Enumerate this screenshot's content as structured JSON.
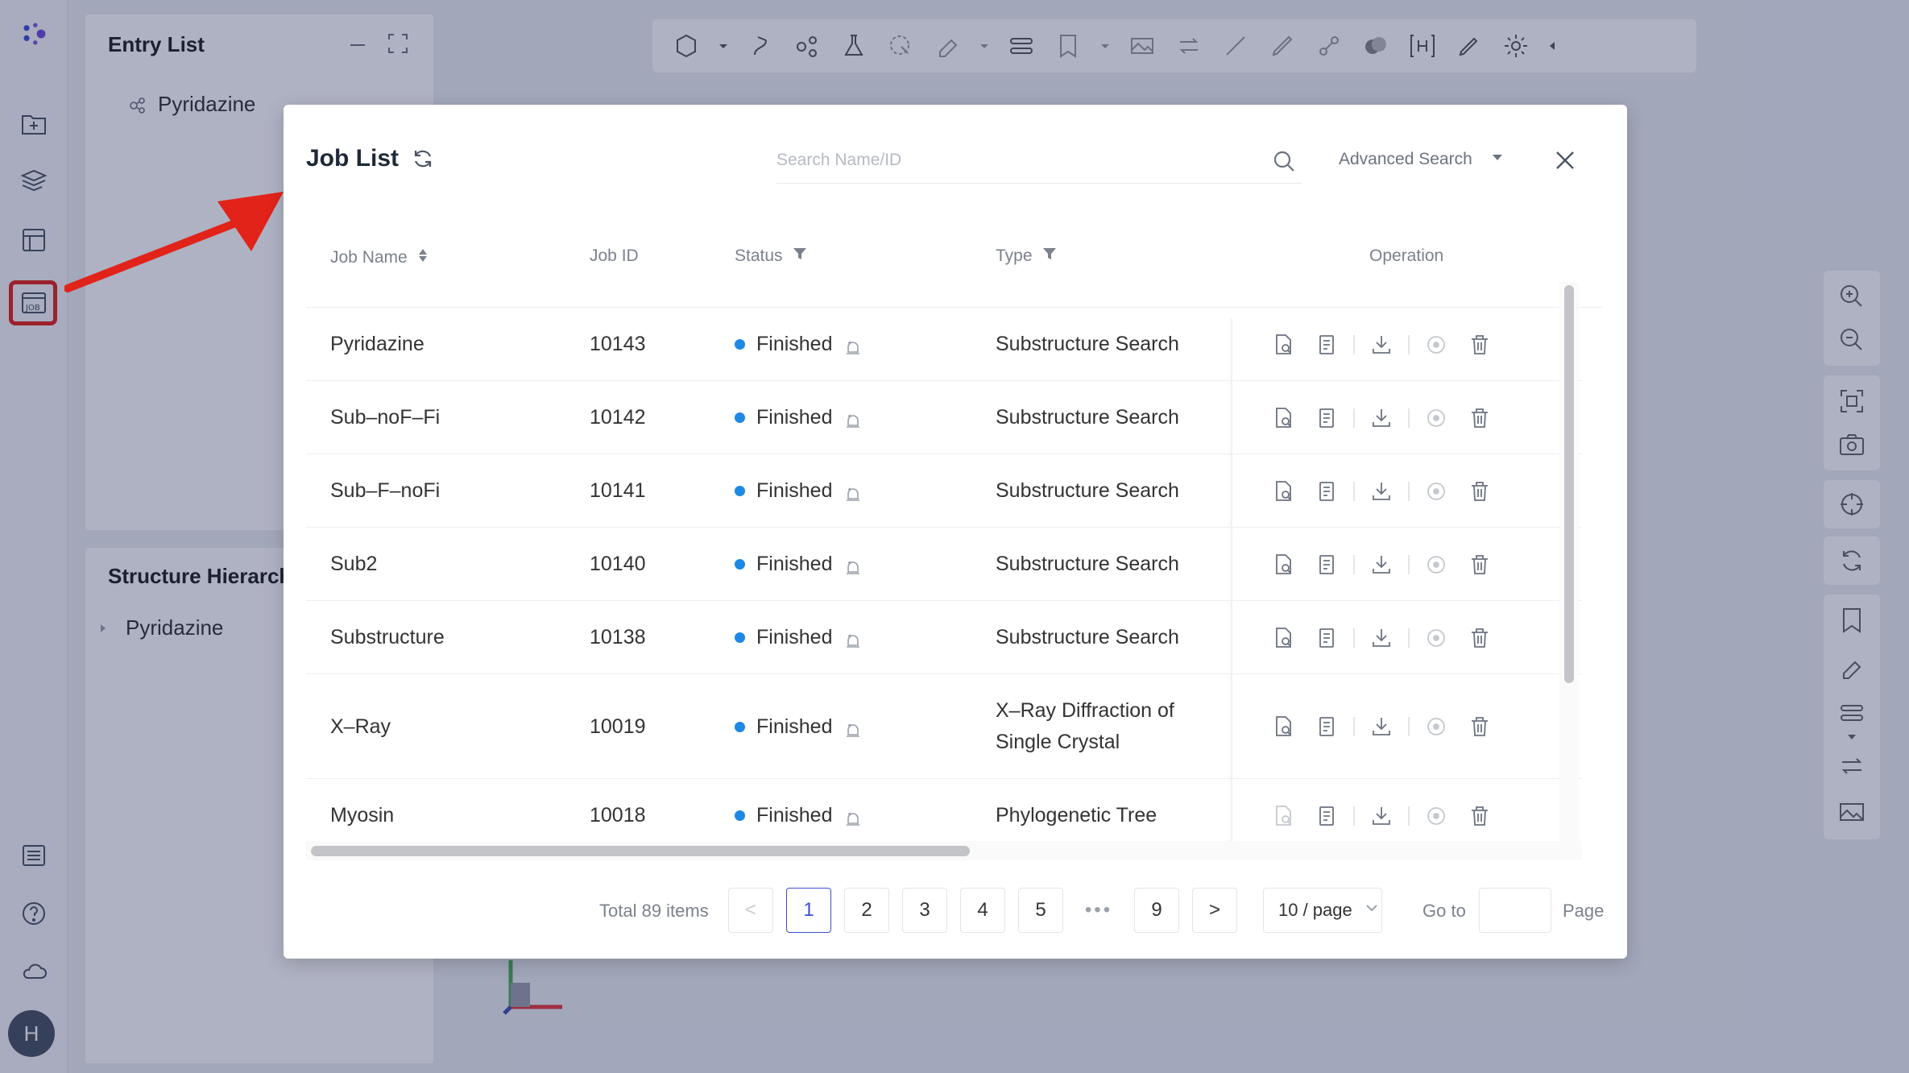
{
  "app": {
    "entry_list": {
      "title": "Entry List",
      "items": [
        {
          "label": "Pyridazine"
        }
      ]
    },
    "structure_hierarchy": {
      "title": "Structure Hierarchy",
      "items": [
        {
          "label": "Pyridazine"
        }
      ]
    },
    "avatar_initial": "H"
  },
  "modal": {
    "title": "Job List",
    "search": {
      "placeholder": "Search Name/ID",
      "value": ""
    },
    "advanced_search_label": "Advanced Search",
    "columns": {
      "job_name": "Job Name",
      "job_id": "Job ID",
      "status": "Status",
      "type": "Type",
      "operation": "Operation"
    },
    "rows": [
      {
        "name": "Pyridazine",
        "id": "10143",
        "status": "Finished",
        "type": "Substructure Search"
      },
      {
        "name": "Sub–noF–Fi",
        "id": "10142",
        "status": "Finished",
        "type": "Substructure Search"
      },
      {
        "name": "Sub–F–noFi",
        "id": "10141",
        "status": "Finished",
        "type": "Substructure Search"
      },
      {
        "name": "Sub2",
        "id": "10140",
        "status": "Finished",
        "type": "Substructure Search"
      },
      {
        "name": "Substructure",
        "id": "10138",
        "status": "Finished",
        "type": "Substructure Search"
      },
      {
        "name": "X–Ray",
        "id": "10019",
        "status": "Finished",
        "type_line1": "X–Ray Diffraction of",
        "type_line2": "Single Crystal"
      },
      {
        "name": "Myosin",
        "id": "10018",
        "status": "Finished",
        "type": "Phylogenetic Tree"
      }
    ],
    "pagination": {
      "total_label": "Total 89 items",
      "prev": "<",
      "next": ">",
      "pages": [
        "1",
        "2",
        "3",
        "4",
        "5"
      ],
      "ellipsis": "•••",
      "last_page": "9",
      "current_page": 1,
      "page_size_label": "10 / page",
      "goto_label": "Go to",
      "goto_value": "",
      "page_label": "Page"
    }
  },
  "colors": {
    "accent": "#3b4fd6",
    "status_finished": "#1e88e5",
    "annotation_red": "#e2231a"
  }
}
